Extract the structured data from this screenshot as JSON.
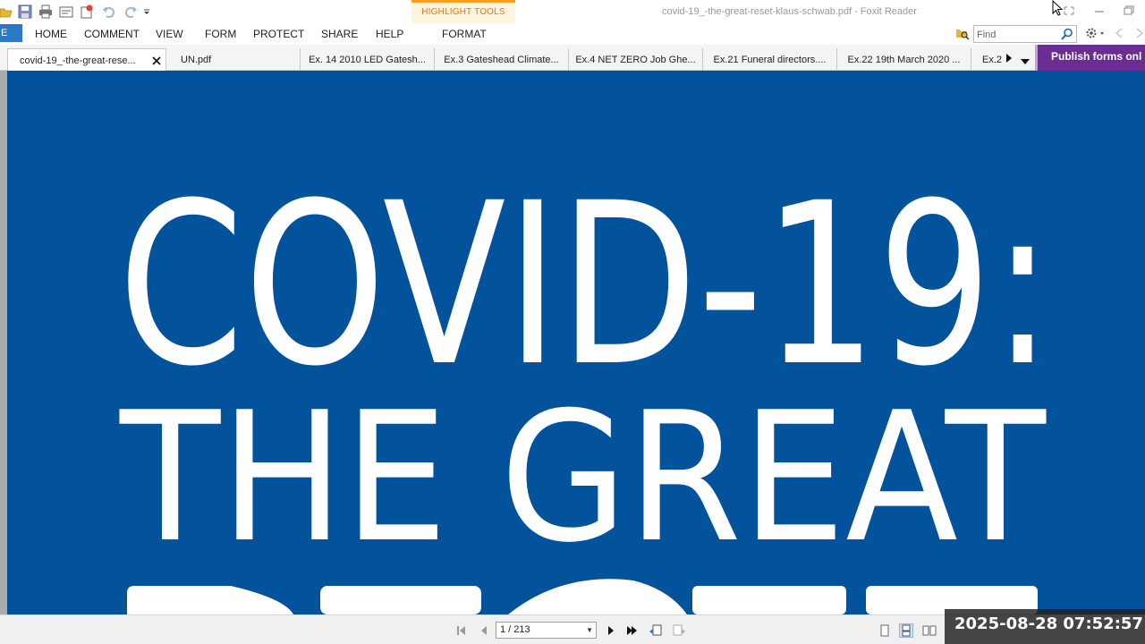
{
  "window": {
    "title": "covid-19_-the-great-reset-klaus-schwab.pdf - Foxit Reader",
    "context_tab": "HIGHLIGHT TOOLS"
  },
  "ribbon": {
    "file_label": "E",
    "tabs": [
      "HOME",
      "COMMENT",
      "VIEW",
      "FORM",
      "PROTECT",
      "SHARE",
      "HELP",
      "FORMAT"
    ],
    "find_placeholder": "Find"
  },
  "doc_tabs": [
    "covid-19_-the-great-rese...",
    "UN.pdf",
    "Ex. 14 2010 LED Gatesh...",
    "Ex.3 Gateshead Climate...",
    "Ex.4 NET ZERO Job Ghe...",
    "Ex.21 Funeral directors....",
    "Ex.22 19th March 2020 ...",
    "Ex.2"
  ],
  "publish_banner": "Publish forms onl",
  "page_content": {
    "line1": "COVID-19:",
    "line2": "THE GREAT"
  },
  "status": {
    "page_indicator": "1 / 213",
    "timestamp": "2025-08-28  07:52:57"
  },
  "colors": {
    "page_background": "#03539c",
    "accent": "#2b78c4",
    "highlight_tools": "#f7a21b",
    "publish_banner": "#6a2d91"
  }
}
